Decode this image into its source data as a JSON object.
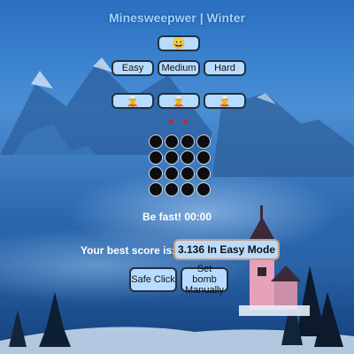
{
  "game": {
    "title": "Minesweepwer | Winter",
    "face_icon": "smiley-face-icon",
    "difficulties": [
      "Easy",
      "Medium",
      "Hard"
    ],
    "characters": [
      "character-icon",
      "character-icon",
      "character-icon"
    ],
    "lives": 2,
    "board": {
      "rows": 4,
      "cols": 4
    },
    "timer_text": "Be fast! 00:00",
    "best_score_label": "Your best score is:",
    "best_score_value": "3.136 In Easy Mode",
    "safe_click_label": "Safe Click",
    "set_bomb_label": "Set bomb Manually"
  },
  "colors": {
    "button_bg": "#b8dcff",
    "button_border": "#23303f",
    "cell": "#0d0d0d",
    "heart": "#d21f2b",
    "title": "#9fd0ff"
  }
}
